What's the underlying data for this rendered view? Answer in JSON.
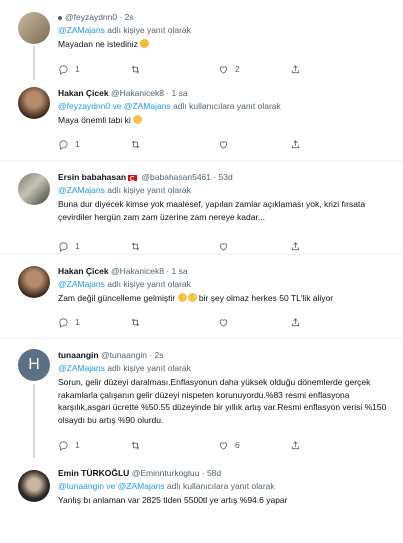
{
  "tweets": [
    {
      "handle": "@feyzaydnn0",
      "time": "2s",
      "reply_prefix": "",
      "reply_mention": "@ZAMajans",
      "reply_suffix": " adlı kişiye yanıt olarak",
      "text": "Mayadan ne istediniz",
      "replies": "1",
      "retweets": "",
      "likes": "2"
    },
    {
      "name": "Hakan Çicek",
      "handle": "@Hakanicek8",
      "time": "1 sa",
      "reply_mention": "@feyzaydnn0 ve @ZAMajans",
      "reply_suffix": " adlı kullanıcılara yanıt olarak",
      "text": "Maya önemli tabi ki",
      "replies": "1",
      "retweets": "",
      "likes": ""
    },
    {
      "name": "Ersin babahasan",
      "handle": "@babahasan5461",
      "time": "53d",
      "reply_mention": "@ZAMajans",
      "reply_suffix": " adlı kişiye yanıt olarak",
      "text": "Buna dur diyecek kimse yok maalesef, yapılan zamlar açıklaması yok, krizi fırsata çevirdiler hergün zam zam üzerine zam nereye kadar...",
      "replies": "1",
      "retweets": "",
      "likes": ""
    },
    {
      "name": "Hakan Çicek",
      "handle": "@Hakanicek8",
      "time": "1 sa",
      "reply_mention": "@ZAMajans",
      "reply_suffix": " adlı kişiye yanıt olarak",
      "text_a": "Zam değil güncelleme gelmiştir",
      "text_b": " bir şey olmaz herkes 50 TL'lik aliyor",
      "replies": "1",
      "retweets": "",
      "likes": ""
    },
    {
      "name": "tunaangin",
      "handle": "@tunaangin",
      "time": "2s",
      "avatar_letter": "H",
      "reply_mention": "@ZAMajans",
      "reply_suffix": " adlı kişiye yanıt olarak",
      "text": "Sorun, gelir düzeyi daralması.Enflasyonun daha yüksek olduğu dönemlerde gerçek rakamlarla çalışanın gelir düzeyi nispeten korunuyordu.%83 resmi enflasyona karşılık,asgari ücrette %50.55 düzeyinde bir yıllık artış var.Resmi enflasyon verisi %150 olsaydı bu artış %90 olurdu.",
      "replies": "1",
      "retweets": "",
      "likes": "6"
    },
    {
      "name": "Emin TÜRKOĞLU",
      "handle": "@Eminnturkogluu",
      "time": "58d",
      "reply_mention": "@tunaangin ve @ZAMajans",
      "reply_suffix": " adlı kullanıcılara yanıt olarak",
      "text": "Yanlış bı anlaman var 2825 tlden 5500tl ye artış %94.6 yapar"
    }
  ],
  "colors": {
    "accent": "#1d9bf0",
    "muted": "#536471",
    "text": "#0f1419",
    "border": "#eff3f4"
  },
  "icons": {
    "reply": "reply-icon",
    "retweet": "retweet-icon",
    "like": "heart-icon",
    "share": "share-icon"
  }
}
